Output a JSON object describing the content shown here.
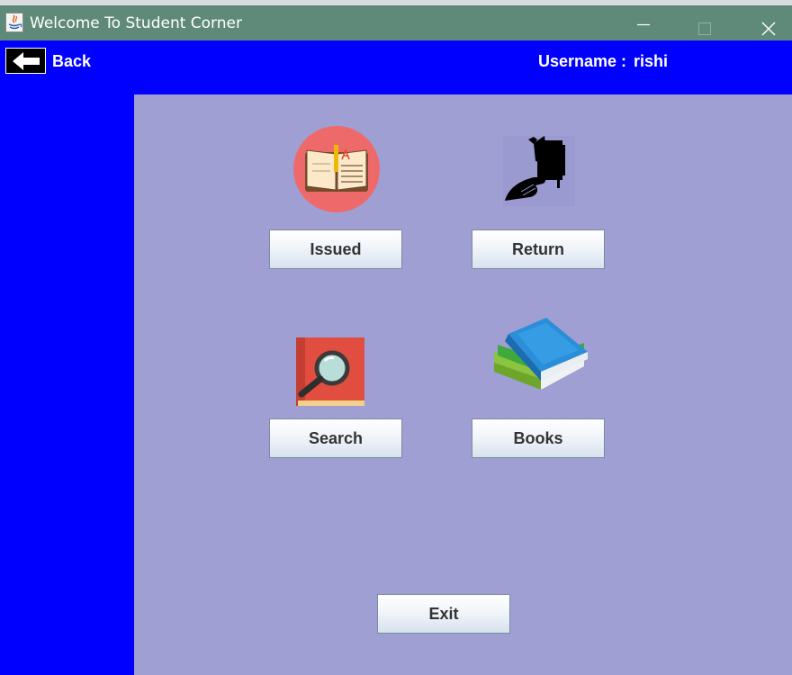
{
  "window": {
    "title": "Welcome To Student Corner",
    "controls": {
      "minimize": "minimize-icon",
      "maximize": "maximize-icon",
      "close": "close-icon"
    }
  },
  "header": {
    "back_label": "Back",
    "back_icon": "left-arrow-icon",
    "username_label": "Username :",
    "username_value": "rishi"
  },
  "menu": {
    "issued_label": "Issued",
    "issued_icon": "open-book-icon",
    "return_label": "Return",
    "return_icon": "hand-returning-book-icon",
    "search_label": "Search",
    "search_icon": "magnifier-book-icon",
    "books_label": "Books",
    "books_icon": "book-stack-icon",
    "exit_label": "Exit"
  },
  "colors": {
    "titlebar": "#5f8a79",
    "header": "#0000ff",
    "sidebar": "#0000ff",
    "panel": "#9f9fd4",
    "button_text": "#333333"
  }
}
